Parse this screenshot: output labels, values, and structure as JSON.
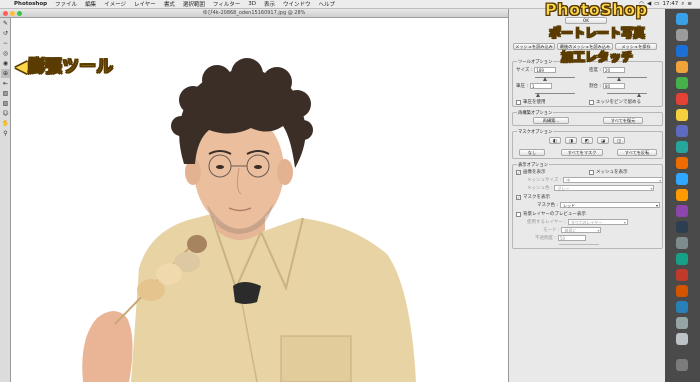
{
  "menubar": {
    "app": "Photoshop",
    "items": [
      "ファイル",
      "編集",
      "イメージ",
      "レイヤー",
      "書式",
      "選択範囲",
      "フィルター",
      "3D",
      "表示",
      "ウインドウ",
      "ヘルプ"
    ],
    "clock": "17:47"
  },
  "window": {
    "title": "ゆぴ4k-20868_oden15160917.jpg @ 28%"
  },
  "overlay": {
    "tool_label": "膨張ツール",
    "title_line1": "PhotoShop",
    "title_line2": "ポートレート写真",
    "title_line3": "加工レタッチ"
  },
  "panel": {
    "ok_label": "OK",
    "load_mesh_label": "メッシュを読み込み",
    "last_mesh_label": "最後のメッシュを読み込み",
    "save_mesh_label": "メッシュを保存",
    "tool_options_title": "ツールオプション",
    "size_label": "サイズ :",
    "size_value": "189",
    "density_label": "密度 :",
    "density_value": "20",
    "pressure_label": "筆圧 :",
    "pressure_value": "1",
    "rate_label": "割合 :",
    "rate_value": "80",
    "stylus_label": "筆圧を使用",
    "pin_edges_label": "エッジをピンで留める",
    "reconstruct_title": "再構築オプション",
    "reconstruct_label": "再構築...",
    "restore_all_label": "すべてを復元",
    "mask_options_title": "マスクオプション",
    "none_label": "なし",
    "mask_all_label": "すべてをマスク",
    "invert_all_label": "すべてを反転",
    "view_options_title": "表示オプション",
    "show_image_label": "画像を表示",
    "show_mesh_label": "メッシュを表示",
    "mesh_size_label": "メッシュサイズ :",
    "mesh_size_value": "中",
    "mesh_color_label": "メッシュ色 :",
    "mesh_color_value": "グレー",
    "show_mask_label": "マスクを表示",
    "mask_color_label": "マスク色 :",
    "mask_color_value": "レッド",
    "show_backdrop_label": "背景レイヤーのプレビュー表示",
    "use_label": "使用するレイヤー :",
    "use_value": "すべてのレイヤー",
    "mode_label": "モード :",
    "mode_value": "前面に",
    "opacity_label": "不透明度 :",
    "opacity_value": "50"
  },
  "colors": {
    "tag_fill": "#ffd84a",
    "tag_stroke": "#5a3b00",
    "panel_bg": "#e9e9e9"
  }
}
